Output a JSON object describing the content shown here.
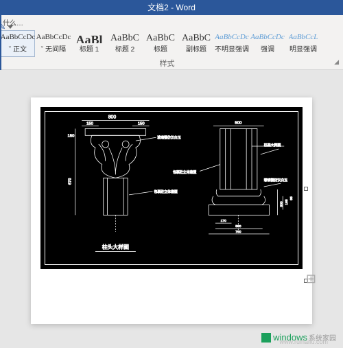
{
  "titlebar": {
    "text": "文档2 - Word"
  },
  "ribbon": {
    "tell_me": "什么…",
    "group_label": "样式",
    "styles": [
      {
        "preview": "AaBbCcDc",
        "label": "˘ 正文",
        "size": "norm",
        "selected": true
      },
      {
        "preview": "AaBbCcDc",
        "label": "˘ 无间隔",
        "size": "norm"
      },
      {
        "preview": "AaBl",
        "label": "标题 1",
        "size": "big"
      },
      {
        "preview": "AaBbC",
        "label": "标题 2",
        "size": "med"
      },
      {
        "preview": "AaBbC",
        "label": "标题",
        "size": "med"
      },
      {
        "preview": "AaBbC",
        "label": "副标题",
        "size": "med"
      },
      {
        "preview": "AaBbCcDc",
        "label": "不明显强调",
        "size": "norm",
        "italic": true
      },
      {
        "preview": "AaBbCcDc",
        "label": "强调",
        "size": "norm",
        "italic": true
      },
      {
        "preview": "AaBbCcL",
        "label": "明显强调",
        "size": "norm",
        "italic": true
      }
    ]
  },
  "cad": {
    "left_title": "柱头大样图",
    "right_title": "柱基大样图",
    "dims": {
      "top_800": "800",
      "top_150a": "150",
      "top_150b": "150",
      "v_150": "150",
      "v_670": "670",
      "r_500": "500",
      "r_300": "300",
      "r_170": "170",
      "r_500b": "500",
      "r_700": "700",
      "r_165": "165",
      "r_85": "85"
    },
    "note1": "玻璃钢仿汉白玉",
    "note2": "包裹砼立体造型",
    "note3": "包裹砼立体造型",
    "note4": "玻璃钢仿汉白玉"
  },
  "watermark": {
    "brand": "windows",
    "tagline": "系统家园",
    "url": "www.ruihaifu.com"
  }
}
